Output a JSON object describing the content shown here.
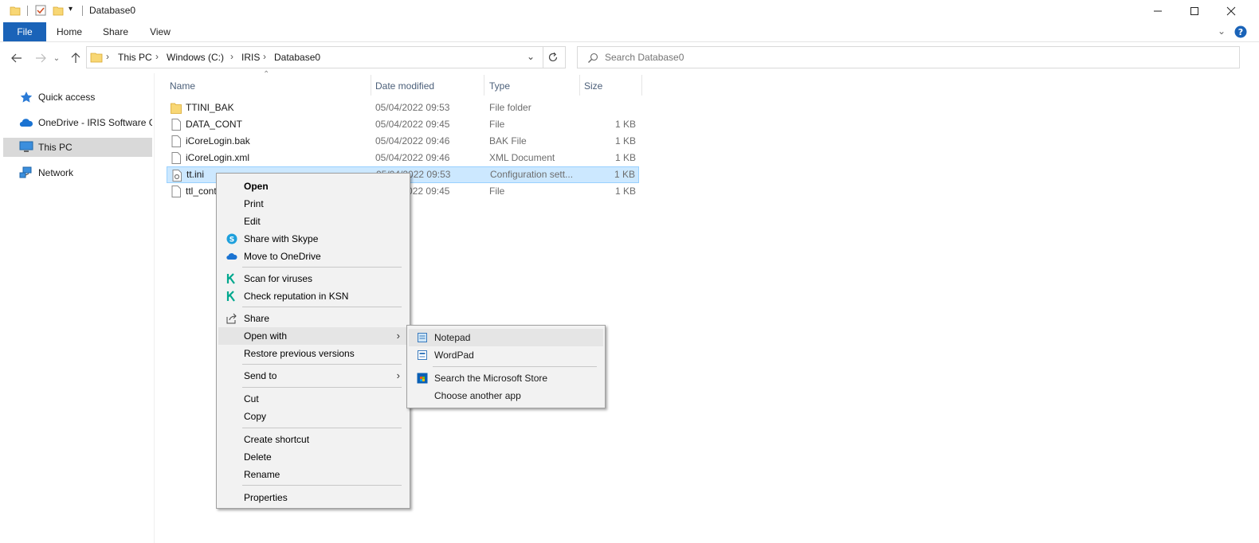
{
  "window": {
    "title": "Database0"
  },
  "ribbon": {
    "tabs": [
      "File",
      "Home",
      "Share",
      "View"
    ]
  },
  "address": {
    "crumbs": [
      "This PC",
      "Windows (C:)",
      "IRIS",
      "Database0"
    ]
  },
  "search": {
    "placeholder": "Search Database0"
  },
  "nav": {
    "items": [
      "Quick access",
      "OneDrive - IRIS Software Group",
      "This PC",
      "Network"
    ]
  },
  "columns": {
    "name": "Name",
    "date": "Date modified",
    "type": "Type",
    "size": "Size"
  },
  "files": [
    {
      "name": "TTINI_BAK",
      "date": "05/04/2022 09:53",
      "type": "File folder",
      "size": ""
    },
    {
      "name": "DATA_CONT",
      "date": "05/04/2022 09:45",
      "type": "File",
      "size": "1 KB"
    },
    {
      "name": "iCoreLogin.bak",
      "date": "05/04/2022 09:46",
      "type": "BAK File",
      "size": "1 KB"
    },
    {
      "name": "iCoreLogin.xml",
      "date": "05/04/2022 09:46",
      "type": "XML Document",
      "size": "1 KB"
    },
    {
      "name": "tt.ini",
      "date": "05/04/2022 09:53",
      "type": "Configuration sett...",
      "size": "1 KB"
    },
    {
      "name": "ttl_cont",
      "date": "05/04/2022 09:45",
      "type": "File",
      "size": "1 KB"
    }
  ],
  "context_menu": {
    "open": "Open",
    "print": "Print",
    "edit": "Edit",
    "skype": "Share with Skype",
    "onedrive": "Move to OneDrive",
    "scan": "Scan for viruses",
    "ksn": "Check reputation in KSN",
    "share": "Share",
    "open_with": "Open with",
    "restore": "Restore previous versions",
    "send_to": "Send to",
    "cut": "Cut",
    "copy": "Copy",
    "shortcut": "Create shortcut",
    "delete": "Delete",
    "rename": "Rename",
    "properties": "Properties"
  },
  "open_with_menu": {
    "notepad": "Notepad",
    "wordpad": "WordPad",
    "store": "Search the Microsoft Store",
    "another": "Choose another app"
  },
  "colors": {
    "accent": "#1a63b8",
    "selected_row": "#cce8ff",
    "folder": "#f8d775"
  }
}
